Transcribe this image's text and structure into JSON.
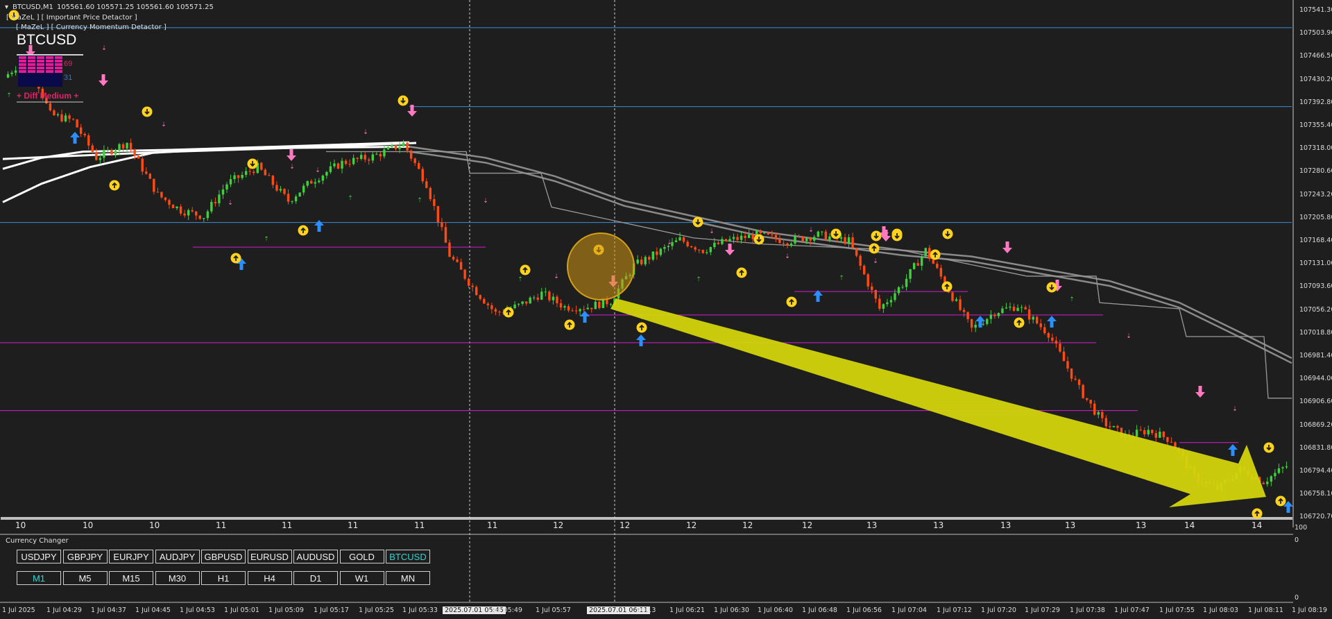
{
  "header": {
    "symbol_timeframe": "BTCUSD,M1",
    "ohlc": "105561.60 105571.25 105561.60 105571.25",
    "indicator1": "[ MaZeL ] [ Important Price Detactor ]",
    "indicator2": "[ MaZeL ] [ Currency Momentum Detactor ]",
    "big_symbol": "BTCUSD",
    "meter_top": "69",
    "meter_bottom": "31",
    "diff_label": "+ Diff Medium +"
  },
  "price_axis": [
    "107541.30",
    "107503.90",
    "107466.50",
    "107430.20",
    "107392.80",
    "107355.40",
    "107318.00",
    "107280.60",
    "107243.20",
    "107205.80",
    "107168.40",
    "107131.00",
    "107093.60",
    "107056.20",
    "107018.80",
    "106981.40",
    "106944.00",
    "106906.60",
    "106869.20",
    "106831.80",
    "106794.40",
    "106758.10",
    "106720.70"
  ],
  "lower_axis": [
    "100",
    "0",
    "0"
  ],
  "hour_markers": [
    "10",
    "10",
    "10",
    "11",
    "11",
    "11",
    "11",
    "11",
    "12",
    "12",
    "12",
    "12",
    "12",
    "13",
    "13",
    "13",
    "13",
    "13",
    "14",
    "14"
  ],
  "time_axis": [
    "1 Jul 2025",
    "1 Jul 04:29",
    "1 Jul 04:37",
    "1 Jul 04:45",
    "1 Jul 04:53",
    "1 Jul 05:01",
    "1 Jul 05:09",
    "1 Jul 05:17",
    "1 Jul 05:25",
    "1 Jul 05:33",
    "2025.07.01 05:45",
    "1 Jul 05:49",
    "1 Jul 05:57",
    "2025.07.01 06:11",
    "06:13",
    "1 Jul 06:21",
    "1 Jul 06:30",
    "1 Jul 06:40",
    "1 Jul 06:48",
    "1 Jul 06:56",
    "1 Jul 07:04",
    "1 Jul 07:12",
    "1 Jul 07:20",
    "1 Jul 07:29",
    "1 Jul 07:38",
    "1 Jul 07:47",
    "1 Jul 07:55",
    "1 Jul 08:03",
    "1 Jul 08:11",
    "1 Jul 08:19"
  ],
  "currency_panel": {
    "title": "Currency Changer",
    "pairs": [
      "USDJPY",
      "GBPJPY",
      "EURJPY",
      "AUDJPY",
      "GBPUSD",
      "EURUSD",
      "AUDUSD",
      "GOLD",
      "BTCUSD"
    ],
    "active_pair": "BTCUSD",
    "timeframes": [
      "M1",
      "M5",
      "M15",
      "M30",
      "H1",
      "H4",
      "D1",
      "W1",
      "MN"
    ],
    "active_timeframe": "M1"
  },
  "colors": {
    "background": "#1e1e1e",
    "bull": "#3fcf3f",
    "bear": "#ff4a14",
    "arrow_up": "#2b8fff",
    "arrow_down": "#ff78c0",
    "marker": "#ffd21e",
    "trend_arrow": "#d4d40c",
    "level_blue": "#3a8fd8",
    "level_magenta": "#d51ed5"
  },
  "chart_data": {
    "type": "candlestick",
    "symbol": "BTCUSD",
    "timeframe": "M1",
    "ylim": [
      106720.7,
      107541.3
    ],
    "x_range": [
      "1 Jul 04:21",
      "1 Jul 08:19"
    ],
    "close_path": [
      [
        0,
        107430
      ],
      [
        6,
        107465
      ],
      [
        12,
        107370
      ],
      [
        18,
        107360
      ],
      [
        24,
        107300
      ],
      [
        32,
        107325
      ],
      [
        40,
        107240
      ],
      [
        46,
        107215
      ],
      [
        52,
        107205
      ],
      [
        58,
        107258
      ],
      [
        66,
        107285
      ],
      [
        74,
        107230
      ],
      [
        80,
        107262
      ],
      [
        88,
        107292
      ],
      [
        96,
        107302
      ],
      [
        104,
        107323
      ],
      [
        110,
        107258
      ],
      [
        116,
        107142
      ],
      [
        122,
        107090
      ],
      [
        128,
        107048
      ],
      [
        134,
        107060
      ],
      [
        140,
        107080
      ],
      [
        146,
        107058
      ],
      [
        152,
        107058
      ],
      [
        158,
        107068
      ],
      [
        164,
        107125
      ],
      [
        170,
        107145
      ],
      [
        176,
        107167
      ],
      [
        182,
        107150
      ],
      [
        188,
        107165
      ],
      [
        196,
        107175
      ],
      [
        204,
        107165
      ],
      [
        212,
        107175
      ],
      [
        220,
        107165
      ],
      [
        228,
        107055
      ],
      [
        234,
        107095
      ],
      [
        240,
        107150
      ],
      [
        246,
        107085
      ],
      [
        252,
        107022
      ],
      [
        258,
        107050
      ],
      [
        264,
        107060
      ],
      [
        272,
        107015
      ],
      [
        280,
        106925
      ],
      [
        286,
        106872
      ],
      [
        292,
        106848
      ],
      [
        298,
        106858
      ],
      [
        304,
        106842
      ],
      [
        310,
        106782
      ],
      [
        316,
        106762
      ],
      [
        322,
        106795
      ],
      [
        328,
        106775
      ],
      [
        334,
        106800
      ]
    ],
    "horizontal_levels": [
      107511,
      107383,
      107195,
      107032
    ],
    "support_levels": [
      107148,
      107076,
      107055,
      106870
    ]
  }
}
